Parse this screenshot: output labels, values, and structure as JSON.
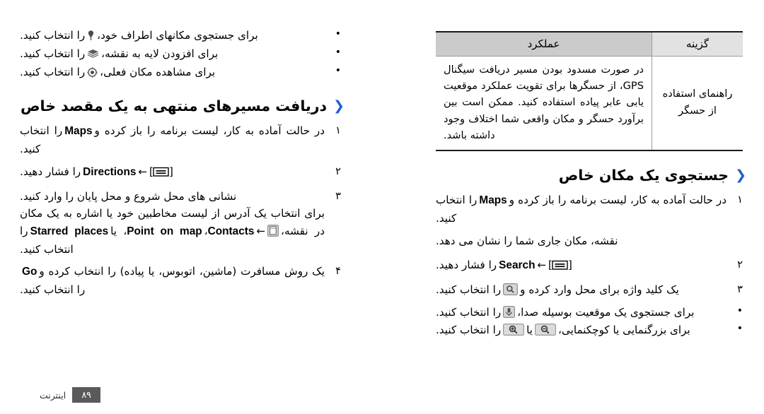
{
  "document": {
    "language": "fa",
    "direction": "rtl",
    "footer": {
      "section_label": "اینترنت",
      "page_number": "۸۹"
    }
  },
  "colors": {
    "heading_chevron": "#1f5fd0",
    "table_header_bg": "#cbcbcb",
    "table_option_header_bg": "#e2e2e2",
    "table_rule": "#1a1a1a",
    "footer_page_bg": "#5a5a5a",
    "text": "#000000"
  },
  "right_column": {
    "table": {
      "headers": {
        "option": "گزینه",
        "function": "عملکرد"
      },
      "rows": [
        {
          "option": "راهنمای استفاده از حسگر",
          "function": "در صورت مسدود بودن مسیر دریافت سیگنال GPS، از حسگرها برای تقویت عملکرد موقعیت یابی عابر پیاده استفاده کنید. ممکن است بین برآورد حسگر و مکان واقعی شما اختلاف وجود داشته باشد."
        }
      ]
    },
    "section": {
      "chevron_icon": "double-chevron-left-icon",
      "title": "جستجوی یک مکان خاص",
      "steps": [
        {
          "number": "۱",
          "text_before": "در حالت آماده به کار، لیست برنامه را باز کرده و",
          "emphasis": "Maps",
          "text_after": "را انتخاب کنید.",
          "note": "نقشه، مکان جاری شما را نشان می دهد."
        },
        {
          "number": "۲",
          "key_icon": "menu-key-icon",
          "arrow": "←",
          "emphasis": "Search",
          "text_after": "را فشار دهید."
        },
        {
          "number": "۳",
          "text_before": "یک کلید واژه برای محل وارد کرده و",
          "inline_icon": "search-button-icon",
          "text_after": "را انتخاب کنید."
        }
      ],
      "bullets": [
        {
          "text_before": "برای جستجوی یک موقعیت بوسیله صدا،",
          "inline_icon": "microphone-button-icon",
          "text_after": "را انتخاب کنید."
        },
        {
          "text_before": "برای بزرگنمایی یا کوچکنمایی،",
          "inline_icon_1": "zoom-out-button-icon",
          "conjunction": "یا",
          "inline_icon_2": "zoom-in-button-icon",
          "text_after": "را انتخاب کنید."
        }
      ]
    }
  },
  "left_column": {
    "top_bullets": [
      {
        "text_before": "برای جستجوی مکانهای اطراف خود،",
        "inline_icon": "map-pin-icon",
        "text_after": "را انتخاب کنید."
      },
      {
        "text_before": "برای افزودن لایه به نقشه،",
        "inline_icon": "layers-icon",
        "text_after": "را انتخاب کنید."
      },
      {
        "text_before": "برای مشاهده مکان فعلی،",
        "inline_icon": "my-location-icon",
        "text_after": "را انتخاب کنید."
      }
    ],
    "section": {
      "chevron_icon": "double-chevron-left-icon",
      "title": "دریافت مسیرهای منتهی به یک مقصد خاص",
      "steps": [
        {
          "number": "۱",
          "text_before": "در حالت آماده به کار، لیست برنامه را باز کرده و",
          "emphasis": "Maps",
          "text_after": "را انتخاب کنید."
        },
        {
          "number": "۲",
          "key_icon": "menu-key-icon",
          "arrow": "←",
          "emphasis": "Directions",
          "text_after": "را فشار دهید."
        },
        {
          "number": "۳",
          "text_line1": "نشانی های محل شروع و محل پایان را وارد کنید.",
          "text_line2": "برای انتخاب یک آدرس از لیست مخاطبین خود یا اشاره به یک مکان در نقشه،",
          "inline_icon": "contacts-book-icon",
          "arrow": "←",
          "emphasis_1": "Contacts",
          "separator_1": "،",
          "emphasis_2": "Point on map",
          "separator_2": "، یا",
          "emphasis_3": "Starred places",
          "text_after": "را انتخاب کنید."
        },
        {
          "number": "۴",
          "text_before": "یک روش مسافرت (ماشین، اتوبوس، یا پیاده) را انتخاب کرده و",
          "emphasis": "Go",
          "text_after": "را انتخاب کنید."
        }
      ]
    }
  }
}
